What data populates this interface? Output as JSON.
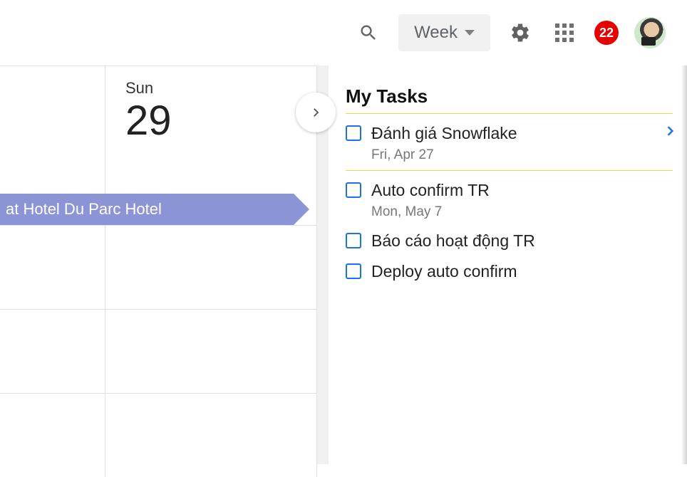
{
  "header": {
    "view_label": "Week",
    "notif_count": "22"
  },
  "calendar": {
    "day_of_week": "Sun",
    "day_number": "29",
    "event_title": "at Hotel Du Parc Hotel"
  },
  "tasks": {
    "title": "My Tasks",
    "items": [
      {
        "title": "Đánh giá Snowflake",
        "date": "Fri, Apr 27",
        "has_arrow": true,
        "sep_after": true
      },
      {
        "title": "Auto confirm TR",
        "date": "Mon, May 7",
        "has_arrow": false,
        "sep_after": false
      },
      {
        "title": "Báo cáo hoạt động TR",
        "date": "",
        "has_arrow": false,
        "sep_after": false
      },
      {
        "title": "Deploy auto confirm",
        "date": "",
        "has_arrow": false,
        "sep_after": false
      }
    ]
  }
}
